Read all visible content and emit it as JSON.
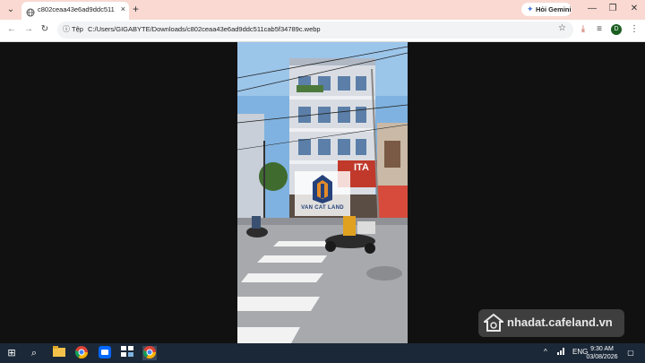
{
  "browser": {
    "tab": {
      "title": "c802ceaa43e6ad9ddc511cab5f34789c.webp",
      "close_glyph": "×",
      "icon": "globe-icon"
    },
    "tab_list_glyph": "⌄",
    "new_tab_glyph": "+",
    "gemini_label": "Hỏi Gemini",
    "gemini_glyph": "✦",
    "window_controls": {
      "minimize": "—",
      "restore": "❐",
      "close": "✕"
    },
    "nav": {
      "back": "←",
      "forward": "→",
      "reload": "↻"
    },
    "address": {
      "info_glyph": "ⓘ",
      "scheme_label": "Tệp",
      "url": "C:/Users/GIGABYTE/Downloads/c802ceaa43e6ad9ddc511cab5f34789c.webp",
      "bookmark_glyph": "☆"
    },
    "toolbar_icons": {
      "download": "⤓",
      "media": "≡",
      "profile_initial": "D",
      "menu": "⋮"
    }
  },
  "image": {
    "logo_text": "VAN CAT LAND",
    "shop_sign_text": "ITA",
    "watermark_text": "nhadat.cafeland.vn"
  },
  "taskbar": {
    "start_glyph": "⊞",
    "search_glyph": "⌕",
    "apps": [
      "file-explorer",
      "chrome",
      "zalo",
      "task-manager",
      "chrome-active"
    ],
    "tray": {
      "chevron": "^",
      "language": "ENG"
    },
    "time": "9:30 AM",
    "date": "03/08/2026",
    "notification_glyph": "▢"
  },
  "colors": {
    "tabstrip": "#f9d9d2",
    "taskbar": "#1b2838",
    "viewer_bg": "#111111"
  }
}
